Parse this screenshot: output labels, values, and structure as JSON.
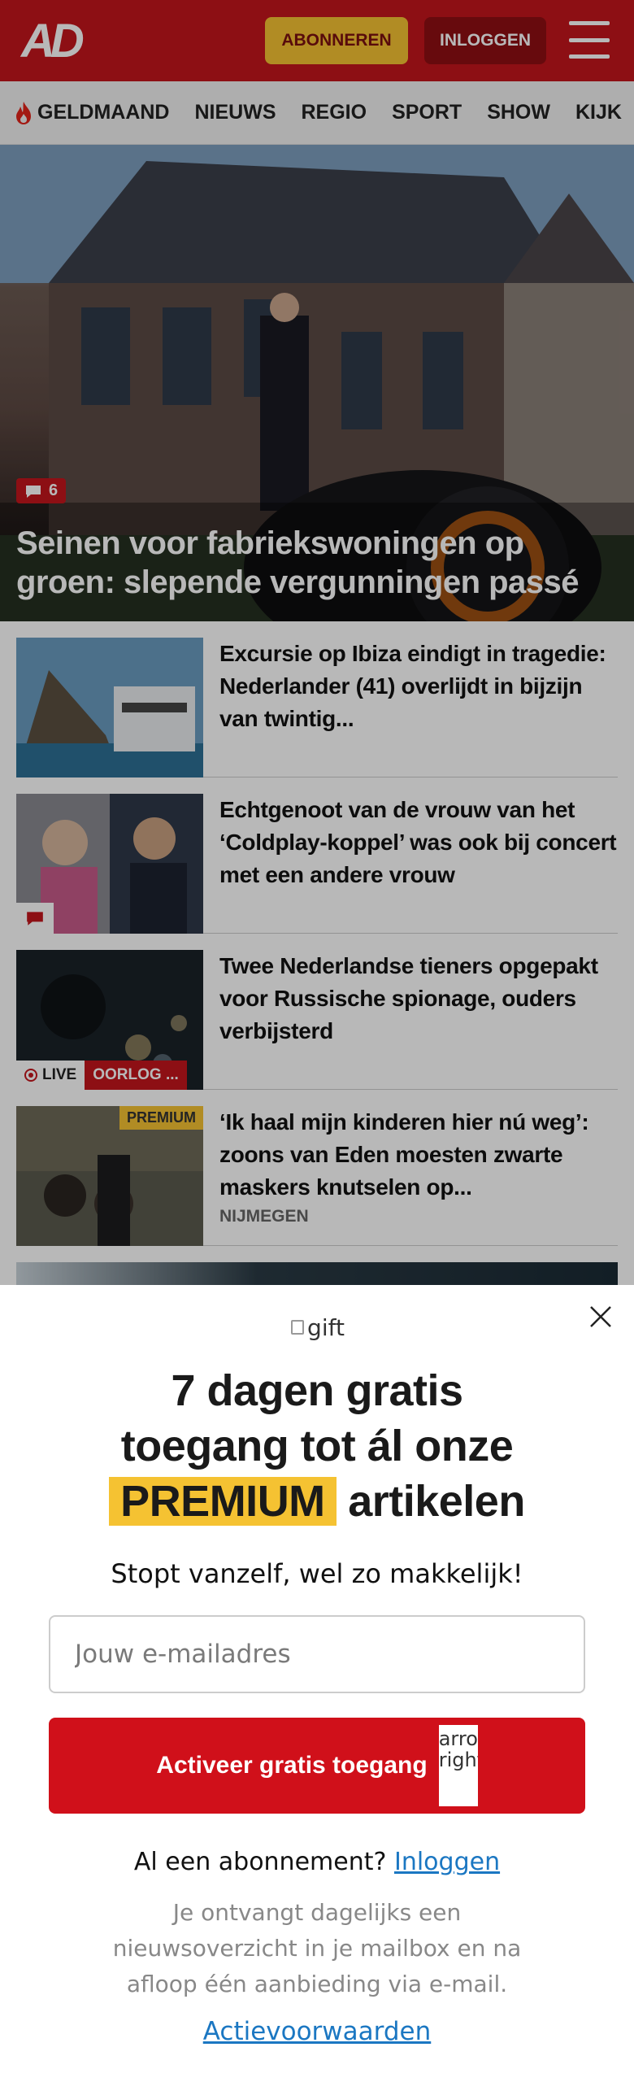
{
  "header": {
    "logo": "AD",
    "subscribe_label": "ABONNEREN",
    "login_label": "INLOGGEN"
  },
  "nav": {
    "items": [
      "GELDMAAND",
      "NIEUWS",
      "REGIO",
      "SPORT",
      "SHOW",
      "KIJK"
    ]
  },
  "hero": {
    "comment_count": "6",
    "title": "Seinen voor fabriekswoningen op groen: slepende vergunningen passé"
  },
  "articles": [
    {
      "title": "Excursie op Ibiza eindigt in tragedie: Nederlander (41) overlijdt in bijzijn van twintig...",
      "tag": ""
    },
    {
      "title": "Echtgenoot van de vrouw van het ‘Coldplay-koppel’ was ook bij concert met een andere vrouw",
      "tag": ""
    },
    {
      "title": "Twee Nederlandse tieners opgepakt voor Russische spionage, ouders verbijsterd",
      "live_label": "LIVE",
      "live_topic": "OORLOG ...",
      "tag": ""
    },
    {
      "title": "‘Ik haal mijn kinderen hier nú weg’: zoons van Eden moesten zwarte maskers knutselen op...",
      "premium_label": "PREMIUM",
      "tag": "NIJMEGEN"
    }
  ],
  "modal": {
    "gift_alt": "gift",
    "title_line1": "7 dagen gratis",
    "title_line2": "toegang tot ál onze",
    "title_premium": "PREMIUM",
    "title_tail": "artikelen",
    "subtitle": "Stopt vanzelf, wel zo makkelijk!",
    "email_placeholder": "Jouw e-mailadres",
    "cta_label": "Activeer gratis toegang",
    "cta_icon_alt": "arrow right",
    "have_subscription": "Al een abonnement?",
    "login_link": "Inloggen",
    "info": "Je ontvangt dagelijks een nieuwsoverzicht in je mailbox en na afloop één aanbieding via e-mail.",
    "terms_link": "Actievoorwaarden"
  },
  "colors": {
    "brand_red": "#c4161c",
    "premium_yellow": "#f5c232",
    "link_blue": "#1b77c2"
  }
}
